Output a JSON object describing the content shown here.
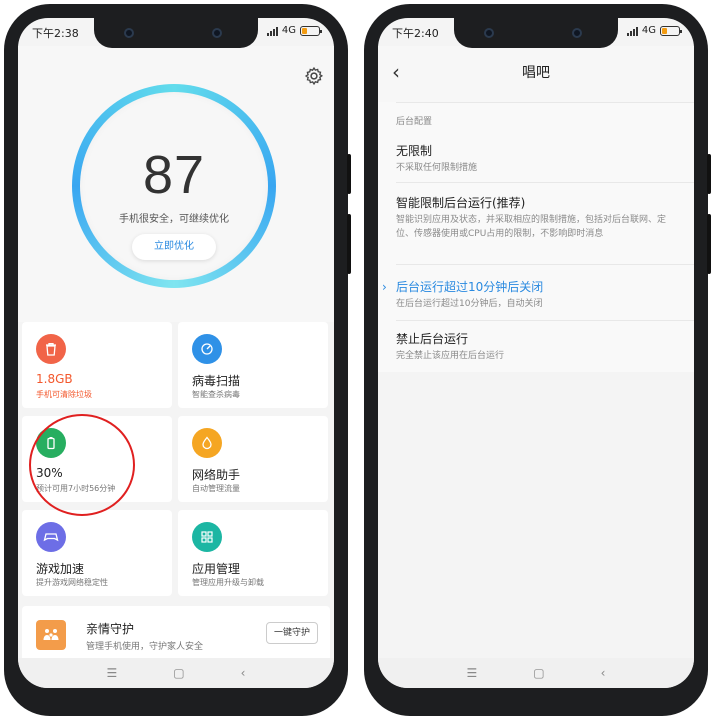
{
  "left_phone": {
    "status": {
      "time": "下午2:38",
      "network": "4G"
    },
    "hero": {
      "score": "87",
      "score_desc": "手机很安全，可继续优化",
      "optimize_button": "立即优化"
    },
    "cards": [
      {
        "title": "1.8GB",
        "sub": "手机可清除垃圾",
        "icon": "trash-icon",
        "color": "#f16448"
      },
      {
        "title": "病毒扫描",
        "sub": "智能查杀病毒",
        "icon": "virus-scan-icon",
        "color": "#2f91e7"
      },
      {
        "title": "30%",
        "sub": "预计可用7小时56分钟",
        "icon": "battery-icon",
        "color": "#27ae60"
      },
      {
        "title": "网络助手",
        "sub": "自动管理流量",
        "icon": "network-icon",
        "color": "#f5a623"
      },
      {
        "title": "游戏加速",
        "sub": "提升游戏网络稳定性",
        "icon": "gamepad-icon",
        "color": "#6d6ee6"
      },
      {
        "title": "应用管理",
        "sub": "管理应用升级与卸载",
        "icon": "apps-grid-icon",
        "color": "#1cb6a3"
      }
    ],
    "family": {
      "title": "亲情守护",
      "sub": "管理手机使用，守护家人安全",
      "button": "一键守护"
    },
    "nav": {
      "menu": "☰",
      "home": "▢",
      "back": "‹"
    }
  },
  "right_phone": {
    "status": {
      "time": "下午2:40",
      "network": "4G"
    },
    "header": {
      "title": "唱吧",
      "back": "‹"
    },
    "section_label": "后台配置",
    "options": [
      {
        "title": "无限制",
        "desc": "不采取任何限制措施"
      },
      {
        "title": "智能限制后台运行(推荐)",
        "desc": "智能识别应用及状态，并采取相应的限制措施，包括对后台联网、定位、传感器使用或CPU占用的限制，不影响即时消息"
      },
      {
        "title": "后台运行超过10分钟后关闭",
        "desc": "在后台运行超过10分钟后，自动关闭",
        "selected": true
      },
      {
        "title": "禁止后台运行",
        "desc": "完全禁止该应用在后台运行"
      }
    ],
    "selected_mark": "›",
    "nav": {
      "menu": "☰",
      "home": "▢",
      "back": "‹"
    }
  },
  "annotation": {
    "color": "#e02020"
  }
}
